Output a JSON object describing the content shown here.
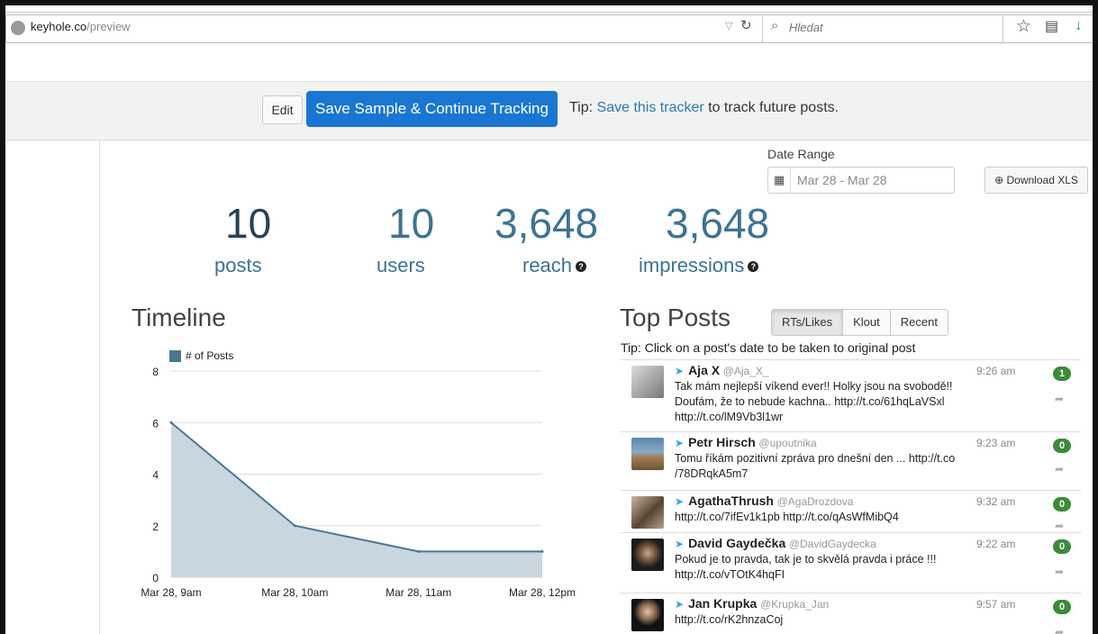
{
  "browser": {
    "url_host": "keyhole.co",
    "url_path": "/preview",
    "search_placeholder": "Hledat"
  },
  "tracker_bar": {
    "edit_label": "Edit",
    "save_label": "Save Sample & Continue Tracking",
    "tip_prefix": "Tip: ",
    "tip_link": "Save this tracker",
    "tip_suffix": " to track future posts."
  },
  "date_range": {
    "label": "Date Range",
    "value": "Mar 28 - Mar 28",
    "download_label": "Download XLS"
  },
  "stats": [
    {
      "value": "10",
      "label": "posts"
    },
    {
      "value": "10",
      "label": "users"
    },
    {
      "value": "3,648",
      "label": "reach"
    },
    {
      "value": "3,648",
      "label": "impressions"
    }
  ],
  "timeline": {
    "title": "Timeline"
  },
  "chart_data": {
    "type": "area",
    "categories": [
      "Mar 28, 9am",
      "Mar 28, 10am",
      "Mar 28, 11am",
      "Mar 28, 12pm"
    ],
    "series": [
      {
        "name": "# of Posts",
        "values": [
          6,
          2,
          1,
          1
        ]
      }
    ],
    "ylim": [
      0,
      8
    ],
    "yticks": [
      0,
      2,
      4,
      6,
      8
    ],
    "grid": true,
    "legend": "top-left",
    "color": "#4a7893",
    "fill": "#c8d7df"
  },
  "top_posts": {
    "title": "Top Posts",
    "tabs": [
      "RTs/Likes",
      "Klout",
      "Recent"
    ],
    "tip": "Tip: Click on a post's date to be taken to original post",
    "posts": [
      {
        "name": "Aja X",
        "handle": "@Aja_X_",
        "time": "9:26 am",
        "count": "1",
        "text": "Tak mám nejlepší víkend ever!! Holky jsou na svobodě!! Doufám, že to nebude kachna.. http://t.co/61hqLaVSxl http://t.co/lM9Vb3l1wr"
      },
      {
        "name": "Petr Hirsch",
        "handle": "@upoutnika",
        "time": "9:23 am",
        "count": "0",
        "text": "Tomu říkám pozitivní zpráva pro dnešní den ... http://t.co /78DRqkA5m7"
      },
      {
        "name": "AgathaThrush",
        "handle": "@AgaDrozdova",
        "time": "9:32 am",
        "count": "0",
        "text": "http://t.co/7ifEv1k1pb http://t.co/qAsWfMibQ4"
      },
      {
        "name": "David Gaydečka",
        "handle": "@DavidGaydecka",
        "time": "9:22 am",
        "count": "0",
        "text": "Pokud je to pravda, tak je to skvělá pravda i práce !!! http://t.co/vTOtK4hqFI"
      },
      {
        "name": "Jan Krupka",
        "handle": "@Krupka_Jan",
        "time": "9:57 am",
        "count": "0",
        "text": "http://t.co/rK2hnzaCoj"
      }
    ]
  }
}
